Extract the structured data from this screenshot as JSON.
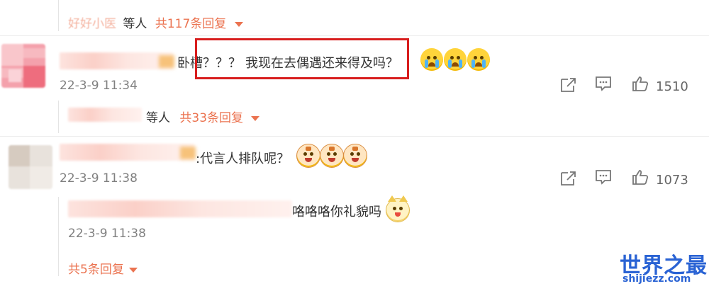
{
  "thread1": {
    "reply_prefix": "好好小医",
    "reply_and_others": "等人",
    "reply_count": "共117条回复"
  },
  "comment1": {
    "text_prefix": "卧槽？？？",
    "text_highlight": "我现在去偶遇还来得及吗？",
    "date": "22-3-9 11:34",
    "likes": "1510"
  },
  "thread2": {
    "reply_and_others": "等人",
    "reply_count": "共33条回复"
  },
  "comment2": {
    "text": ":代言人排队呢？",
    "date": "22-3-9 11:38",
    "likes": "1073"
  },
  "subreply": {
    "text": "咯咯咯你礼貌吗",
    "date": "22-3-9 11:38",
    "reply_count": "共5条回复"
  },
  "watermark": {
    "title": "世界之最",
    "url": "shijiezz.com"
  },
  "icons": {
    "share": "share-icon",
    "comment": "comment-icon",
    "like": "thumbs-up-icon",
    "caret": "chevron-down-icon"
  },
  "colors": {
    "accent": "#eb7350",
    "highlight_border": "#d81e1e",
    "watermark": "#2a63d4"
  }
}
